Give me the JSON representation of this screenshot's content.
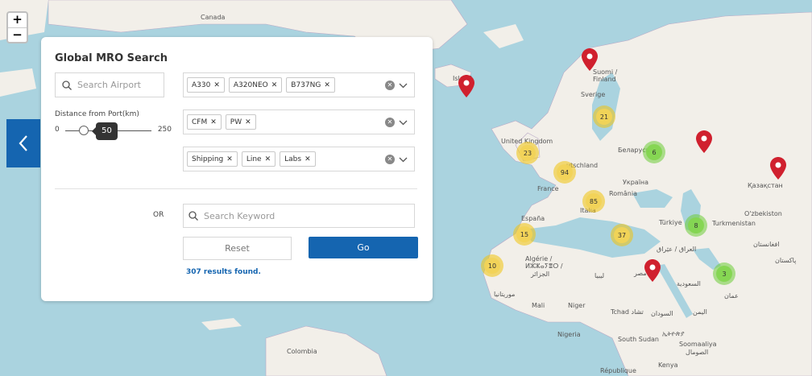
{
  "map": {
    "zoom_in": "+",
    "zoom_out": "−",
    "labels": [
      {
        "text": "Canada"
      },
      {
        "text": "Island"
      },
      {
        "text": "Suomi /"
      },
      {
        "text": "Finland"
      },
      {
        "text": "Sverige"
      },
      {
        "text": "United Kingdom"
      },
      {
        "text": "Беларусь"
      },
      {
        "text": "utschland"
      },
      {
        "text": "France"
      },
      {
        "text": "Україна"
      },
      {
        "text": "România"
      },
      {
        "text": "Italia"
      },
      {
        "text": "España"
      },
      {
        "text": "Türkiye"
      },
      {
        "text": "Қазақстан"
      },
      {
        "text": "O'zbekiston"
      },
      {
        "text": "Turkmenistan"
      },
      {
        "text": "افغانستان"
      },
      {
        "text": "پاکستان"
      },
      {
        "text": "العراق / عێراق"
      },
      {
        "text": "Algérie /"
      },
      {
        "text": "ⵍⵣⵣⴰⵢⴻⵔ /"
      },
      {
        "text": "الجزائر"
      },
      {
        "text": "ليبيا"
      },
      {
        "text": "مصر"
      },
      {
        "text": "السعودية"
      },
      {
        "text": "عمان"
      },
      {
        "text": "موريتانيا"
      },
      {
        "text": "Mali"
      },
      {
        "text": "Niger"
      },
      {
        "text": "Tchad تشاد"
      },
      {
        "text": "السودان"
      },
      {
        "text": "اليمن"
      },
      {
        "text": "Nigeria"
      },
      {
        "text": "South Sudan"
      },
      {
        "text": "ኢትዮጵያ"
      },
      {
        "text": "Soomaaliya"
      },
      {
        "text": "الصومال"
      },
      {
        "text": "Kenya"
      },
      {
        "text": "Colombia"
      },
      {
        "text": "République"
      }
    ],
    "clusters": [
      {
        "count": "21",
        "color": "yellow"
      },
      {
        "count": "6",
        "color": "green"
      },
      {
        "count": "23",
        "color": "yellow"
      },
      {
        "count": "94",
        "color": "yellow"
      },
      {
        "count": "85",
        "color": "yellow"
      },
      {
        "count": "37",
        "color": "yellow"
      },
      {
        "count": "8",
        "color": "green"
      },
      {
        "count": "15",
        "color": "yellow"
      },
      {
        "count": "10",
        "color": "yellow"
      },
      {
        "count": "3",
        "color": "green"
      }
    ],
    "pin_color": "#d0202e"
  },
  "panel": {
    "title": "Global MRO Search",
    "airport_placeholder": "Search Airport",
    "distance_label": "Distance from Port(km)",
    "slider": {
      "min": "0",
      "max": "250",
      "value": "50"
    },
    "aircraft_tags": [
      "A330",
      "A320NEO",
      "B737NG"
    ],
    "engine_tags": [
      "CFM",
      "PW"
    ],
    "category_tags": [
      "Shipping",
      "Line",
      "Labs"
    ],
    "or_label": "OR",
    "keyword_placeholder": "Search Keyword",
    "reset_label": "Reset",
    "go_label": "Go",
    "results_text": "307 results found.",
    "accent_color": "#1565b0"
  }
}
